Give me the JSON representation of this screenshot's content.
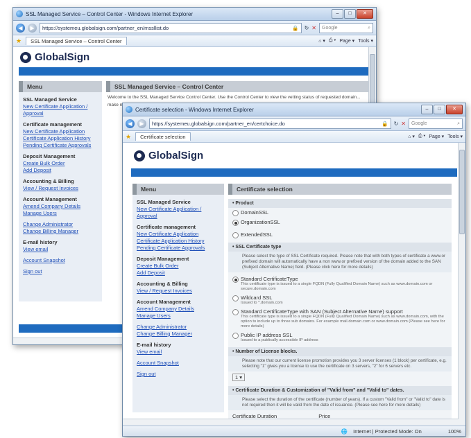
{
  "back": {
    "title": "SSL Managed Service – Control Center - Windows Internet Explorer",
    "url": "https://systemeu.globalsign.com/partner_en/mssllist.do",
    "search_placeholder": "Google",
    "tab": "SSL Managed Service – Control Center",
    "logo": "GlobalSign",
    "menu_header": "Menu",
    "main_header": "SSL Managed Service – Control Center",
    "intro": "Welcome to the SSL Managed Service Control Center. Use the Control Center to view the vetting status of requested domain...",
    "intro2": "make ne",
    "groups": [
      {
        "title": "SSL Managed Service",
        "links": [
          "New Certificate Application /",
          "Approval"
        ]
      },
      {
        "title": "Certificate management",
        "links": [
          "New Certificate Application",
          "Certificate Application History",
          "Pending Certificate Approvals"
        ]
      },
      {
        "title": "Deposit Management",
        "links": [
          "Create Bulk Order",
          "Add Deposit"
        ]
      },
      {
        "title": "Accounting & Billing",
        "links": [
          "View / Request Invoices"
        ]
      },
      {
        "title": "Account Management",
        "links": [
          "Amend Company Details",
          "Manage Users"
        ]
      },
      {
        "title": "",
        "links": [
          "Change Administrator",
          "Change Billing Manager"
        ]
      },
      {
        "title": "E-mail history",
        "links": [
          "View email"
        ]
      },
      {
        "title": "",
        "links": [
          "Account Snapshot"
        ]
      },
      {
        "title": "",
        "links": [
          "Sign out"
        ]
      }
    ]
  },
  "front": {
    "title": "Certificate selection - Windows Internet Explorer",
    "url": "https://systemeu.globalsign.com/partner_en/certchoice.do",
    "search_placeholder": "Google",
    "tab": "Certificate selection",
    "cmd": [
      "Page ▾",
      "Tools ▾"
    ],
    "logo": "GlobalSign",
    "menu_header": "Menu",
    "main_header": "Certificate selection",
    "groups": [
      {
        "title": "SSL Managed Service",
        "links": [
          "New Certificate Application /",
          "Approval"
        ]
      },
      {
        "title": "Certificate management",
        "links": [
          "New Certificate Application",
          "Certificate Application History",
          "Pending Certificate Approvals"
        ]
      },
      {
        "title": "Deposit Management",
        "links": [
          "Create Bulk Order",
          "Add Deposit"
        ]
      },
      {
        "title": "Accounting & Billing",
        "links": [
          "View / Request Invoices"
        ]
      },
      {
        "title": "Account Management",
        "links": [
          "Amend Company Details",
          "Manage Users"
        ]
      },
      {
        "title": "",
        "links": [
          "Change Administrator",
          "Change Billing Manager"
        ]
      },
      {
        "title": "E-mail history",
        "links": [
          "View email"
        ]
      },
      {
        "title": "",
        "links": [
          "Account Snapshot"
        ]
      },
      {
        "title": "",
        "links": [
          "Sign out"
        ]
      }
    ],
    "product_header": "• Product",
    "products": [
      "DomainSSL",
      "OrganizationSSL",
      "ExtendedSSL"
    ],
    "ssl_type_header": "• SSL Certificate type",
    "ssl_type_note": "Please select the type of SSL Certificate required. Please note that with both types of certificate a www.or prefixed domain will automatically have a non www.or prefixed version of the domain added to the SAN (Subject Alternative Name) field. (Please click here for more details)",
    "types": [
      {
        "label": "Standard CertificateType",
        "sub": "This certificate type is issued to a single FQDN (Fully Qualified Domain Name) such as www.domain.com or secure.domain.com"
      },
      {
        "label": "Wildcard SSL",
        "sub": "Issued to *.domain.com"
      },
      {
        "label": "Standard CertificateType with SAN (Subject Alternative Name) support",
        "sub": "This certificate type is issued to a single FQDN (Fully Qualified Domain Name) such as www.domain.com, with the option to include up to three sub domains. For example mail.domain.com or www.domain.com (Please see here for more details)"
      },
      {
        "label": "Public IP address SSL",
        "sub": "Issued to a publically accessible IP address"
      }
    ],
    "licenses_header": "• Number of License blocks.",
    "licenses_note": "Please note that our current license promotion provides you 3 server licenses (1 block) per certificate, e.g. selecting \"1\" gives you a license to use the certificate on 3 servers, \"2\" for 6 servers etc.",
    "licenses_value": "1 ▾",
    "duration_header": "• Certificate Duration & Customization of \"Valid from\" and \"Valid to\" dates.",
    "duration_note": "Please select the duration of the certificate (number of years). If a custom \"Valid from\" or \"Valid to\" date is not required then it will be valid from the date of issuance. (Please see here for more details)",
    "duration_label": "Certificate Duration",
    "price_label": "Price",
    "status": "Internet | Protected Mode: On",
    "zoom": "100%"
  }
}
